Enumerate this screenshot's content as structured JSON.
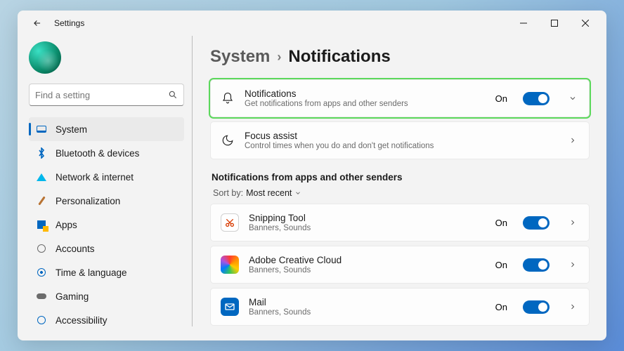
{
  "window": {
    "title": "Settings"
  },
  "search": {
    "placeholder": "Find a setting"
  },
  "sidebar": {
    "items": [
      {
        "label": "System"
      },
      {
        "label": "Bluetooth & devices"
      },
      {
        "label": "Network & internet"
      },
      {
        "label": "Personalization"
      },
      {
        "label": "Apps"
      },
      {
        "label": "Accounts"
      },
      {
        "label": "Time & language"
      },
      {
        "label": "Gaming"
      },
      {
        "label": "Accessibility"
      }
    ]
  },
  "breadcrumb": {
    "parent": "System",
    "current": "Notifications"
  },
  "notif_card": {
    "title": "Notifications",
    "sub": "Get notifications from apps and other senders",
    "state": "On"
  },
  "focus_card": {
    "title": "Focus assist",
    "sub": "Control times when you do and don't get notifications"
  },
  "section_title": "Notifications from apps and other senders",
  "sort": {
    "label": "Sort by:",
    "value": "Most recent"
  },
  "apps": [
    {
      "name": "Snipping Tool",
      "sub": "Banners, Sounds",
      "state": "On"
    },
    {
      "name": "Adobe Creative Cloud",
      "sub": "Banners, Sounds",
      "state": "On"
    },
    {
      "name": "Mail",
      "sub": "Banners, Sounds",
      "state": "On"
    }
  ]
}
